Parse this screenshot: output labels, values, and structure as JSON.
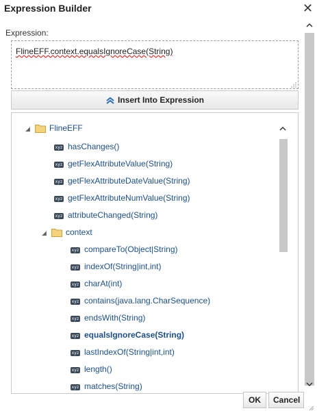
{
  "dialog": {
    "title": "Expression Builder",
    "close_glyph": "✕"
  },
  "expression": {
    "label": "Expression:",
    "value": "FlineEFF.context.equalsIgnoreCase(String)"
  },
  "insert_button": {
    "label": "Insert Into Expression",
    "icon": "double-chevron-up-icon"
  },
  "tree": {
    "root": {
      "label": "FlineEFF",
      "expanded": true
    },
    "root_items": [
      "hasChanges()",
      "getFlexAttributeValue(String)",
      "getFlexAttributeDateValue(String)",
      "getFlexAttributeNumValue(String)",
      "attributeChanged(String)"
    ],
    "child": {
      "label": "context",
      "expanded": true
    },
    "child_items": [
      "compareTo(Object|String)",
      "indexOf(String|int,int)",
      "charAt(int)",
      "contains(java.lang.CharSequence)",
      "endsWith(String)",
      "equalsIgnoreCase(String)",
      "lastIndexOf(String|int,int)",
      "length()",
      "matches(String)"
    ],
    "selected": "equalsIgnoreCase(String)",
    "method_icon_text": "xyz"
  },
  "footer": {
    "ok_label": "OK",
    "cancel_label": "Cancel"
  },
  "colors": {
    "link": "#1b4f8b",
    "folder": "#e8c35a"
  }
}
